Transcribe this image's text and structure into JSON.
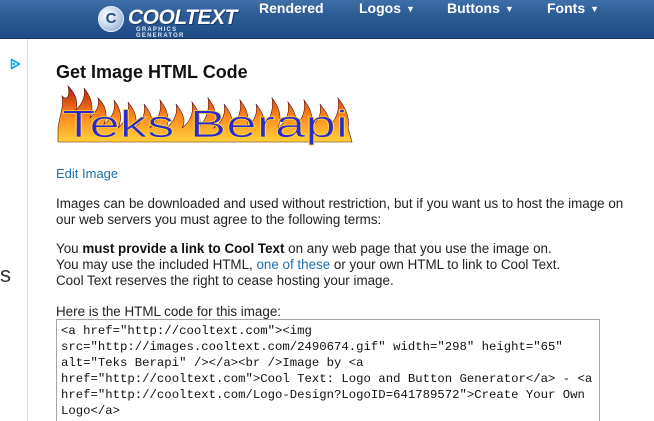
{
  "header": {
    "logo_letter": "C",
    "logo_text": "COOLTEXT",
    "logo_sub": "GRAPHICS GENERATOR",
    "nav": [
      {
        "label": "Rendered",
        "has_menu": false
      },
      {
        "label": "Logos",
        "has_menu": true
      },
      {
        "label": "Buttons",
        "has_menu": true
      },
      {
        "label": "Fonts",
        "has_menu": true
      }
    ],
    "caret": "▼"
  },
  "sidebar": {
    "fragment": "s"
  },
  "main": {
    "title": "Get Image HTML Code",
    "rendered_image_text": "Teks Berapi",
    "edit_link": "Edit Image",
    "terms_intro": "Images can be downloaded and used without restriction, but if you want us to host the image on our web servers you must agree to the following terms:",
    "term1_prefix": "You ",
    "term1_bold": "must provide a link to Cool Text",
    "term1_suffix": " on any web page that you use the image on.",
    "term2_prefix": "You may use the included HTML, ",
    "term2_link": "one of these",
    "term2_suffix": " or your own HTML to link to Cool Text.",
    "term3": "Cool Text reserves the right to cease hosting your image.",
    "code_label": "Here is the HTML code for this image:",
    "code": "<a href=\"http://cooltext.com\"><img src=\"http://images.cooltext.com/2490674.gif\" width=\"298\" height=\"65\" alt=\"Teks Berapi\" /></a><br />Image by <a href=\"http://cooltext.com\">Cool Text: Logo and Button Generator</a> - <a href=\"http://cooltext.com/Logo-Design?LogoID=641789572\">Create Your Own Logo</a>"
  },
  "colors": {
    "header_bar": "#2b5a93",
    "link": "#1f6fa8",
    "fire_outer": "#e2571b",
    "fire_inner": "#ffd23a",
    "text_fill": "#2a2ad0"
  }
}
